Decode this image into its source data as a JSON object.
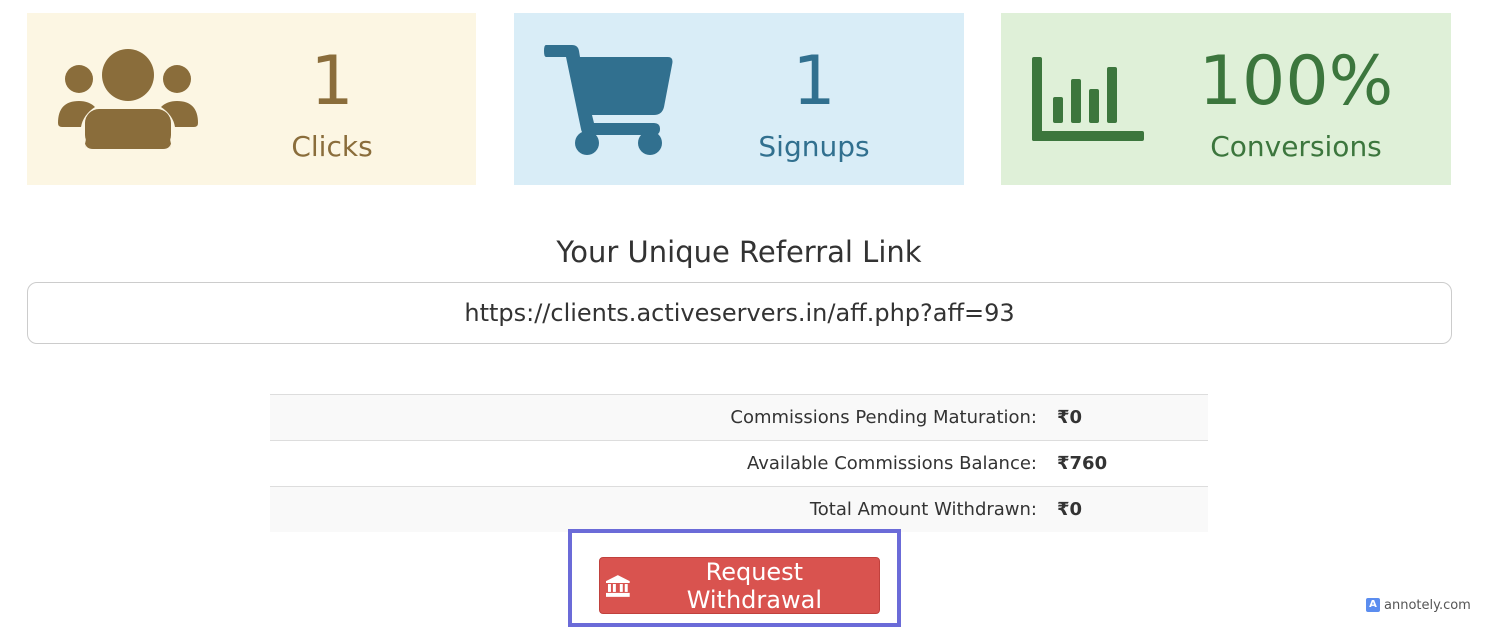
{
  "stats": {
    "clicks": {
      "value": "1",
      "label": "Clicks",
      "icon": "users-icon",
      "bg": "#fcf6e3",
      "color": "#8a6d3b"
    },
    "signups": {
      "value": "1",
      "label": "Signups",
      "icon": "shopping-cart-icon",
      "bg": "#d9edf7",
      "color": "#31708f"
    },
    "conversions": {
      "value": "100%",
      "label": "Conversions",
      "icon": "bar-chart-icon",
      "bg": "#dff0d8",
      "color": "#3c763d"
    }
  },
  "referral": {
    "title": "Your Unique Referral Link",
    "url": "https://clients.activeservers.in/aff.php?aff=93"
  },
  "commissions": {
    "rows": [
      {
        "label": "Commissions Pending Maturation:",
        "value": "₹0"
      },
      {
        "label": "Available Commissions Balance:",
        "value": "₹760"
      },
      {
        "label": "Total Amount Withdrawn:",
        "value": "₹0"
      }
    ]
  },
  "withdraw": {
    "label": "Request Withdrawal",
    "icon": "bank-icon",
    "color": "#d9534f",
    "highlight_color": "#6b6bd8"
  },
  "watermark": {
    "text": "annotely.com"
  }
}
